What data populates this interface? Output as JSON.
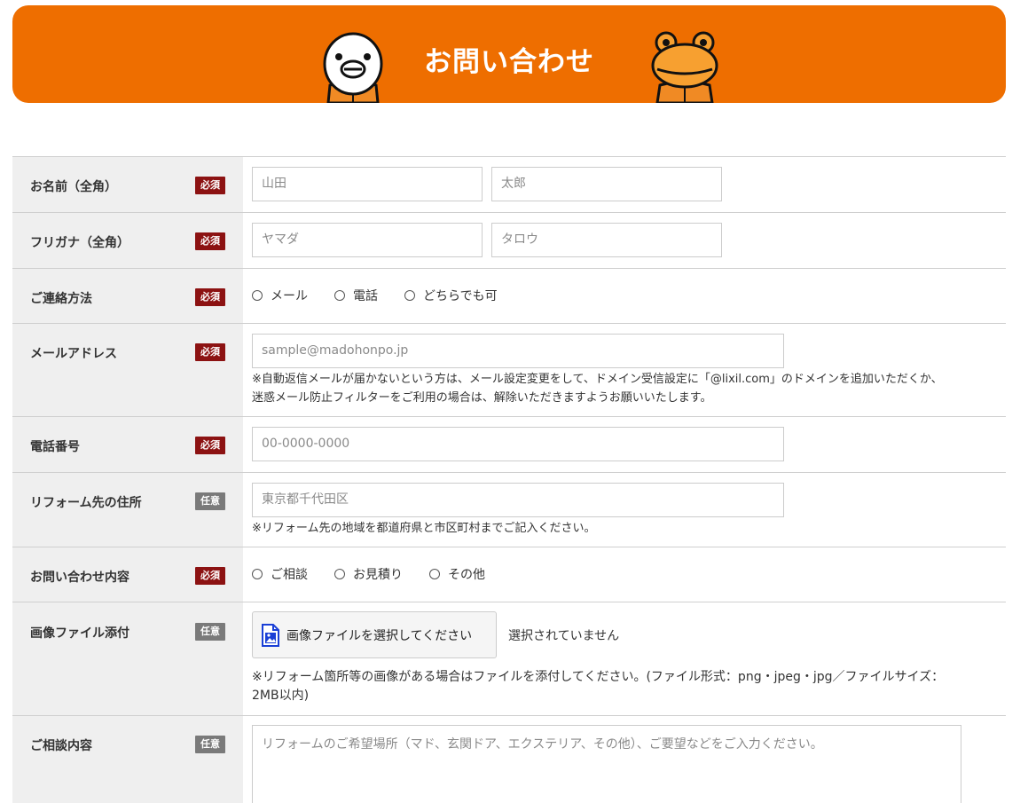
{
  "header": {
    "title": "お問い合わせ"
  },
  "badges": {
    "required": "必須",
    "optional": "任意"
  },
  "form": {
    "name": {
      "label": "お名前（全角）",
      "last_placeholder": "山田",
      "first_placeholder": "太郎"
    },
    "furigana": {
      "label": "フリガナ（全角）",
      "last_placeholder": "ヤマダ",
      "first_placeholder": "タロウ"
    },
    "contact_method": {
      "label": "ご連絡方法",
      "options": [
        "メール",
        "電話",
        "どちらでも可"
      ]
    },
    "email": {
      "label": "メールアドレス",
      "placeholder": "sample@madohonpo.jp",
      "note_line1": "※自動返信メールが届かないという方は、メール設定変更をして、ドメイン受信設定に「@lixil.com」のドメインを追加いただくか、",
      "note_line2": "迷惑メール防止フィルターをご利用の場合は、解除いただきますようお願いいたします。"
    },
    "phone": {
      "label": "電話番号",
      "placeholder": "00-0000-0000"
    },
    "address": {
      "label": "リフォーム先の住所",
      "placeholder": "東京都千代田区",
      "note": "※リフォーム先の地域を都道府県と市区町村までご記入ください。"
    },
    "inquiry_type": {
      "label": "お問い合わせ内容",
      "options": [
        "ご相談",
        "お見積り",
        "その他"
      ]
    },
    "image": {
      "label": "画像ファイル添付",
      "button_label": "画像ファイルを選択してください",
      "status": "選択されていません",
      "note_line1": "※リフォーム箇所等の画像がある場合はファイルを添付してください。(ファイル形式：png・jpeg・jpg／ファイルサイズ：",
      "note_line2": "2MB以内)"
    },
    "consultation": {
      "label": "ご相談内容",
      "placeholder": "リフォームのご希望場所（マド、玄関ドア、エクステリア、その他）、ご要望などをご入力ください。"
    }
  },
  "colors": {
    "banner": "#ee6e00",
    "required_badge": "#8c1212",
    "optional_badge": "#7a7a7a",
    "label_bg": "#efefef"
  }
}
